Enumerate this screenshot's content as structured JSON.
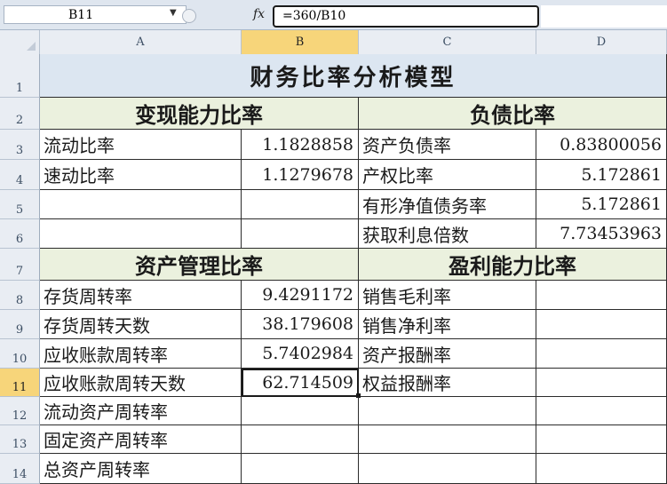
{
  "formula_bar": {
    "name_box": "B11",
    "formula": "=360/B10"
  },
  "columns": [
    "A",
    "B",
    "C",
    "D"
  ],
  "rows": [
    "1",
    "2",
    "3",
    "4",
    "5",
    "6",
    "7",
    "8",
    "9",
    "10",
    "11",
    "12",
    "13",
    "14"
  ],
  "sheet": {
    "title": "财务比率分析模型",
    "sections": {
      "liquidity": "变现能力比率",
      "debt": "负债比率",
      "asset_mgmt": "资产管理比率",
      "profit": "盈利能力比率"
    },
    "liquidity_rows": [
      {
        "label": "流动比率",
        "value": "1.1828858"
      },
      {
        "label": "速动比率",
        "value": "1.1279678"
      }
    ],
    "debt_rows": [
      {
        "label": "资产负债率",
        "value": "0.83800056"
      },
      {
        "label": "产权比率",
        "value": "5.172861"
      },
      {
        "label": "有形净值债务率",
        "value": "5.172861"
      },
      {
        "label": "获取利息倍数",
        "value": "7.73453963"
      }
    ],
    "asset_rows": [
      {
        "label": "存货周转率",
        "value": "9.4291172"
      },
      {
        "label": "存货周转天数",
        "value": "38.179608"
      },
      {
        "label": "应收账款周转率",
        "value": "5.7402984"
      },
      {
        "label": "应收账款周转天数",
        "value": "62.714509"
      },
      {
        "label": "流动资产周转率",
        "value": ""
      },
      {
        "label": "固定资产周转率",
        "value": ""
      },
      {
        "label": "总资产周转率",
        "value": ""
      }
    ],
    "profit_rows": [
      {
        "label": "销售毛利率",
        "value": ""
      },
      {
        "label": "销售净利率",
        "value": ""
      },
      {
        "label": "资产报酬率",
        "value": ""
      },
      {
        "label": "权益报酬率",
        "value": ""
      }
    ]
  },
  "colors": {
    "title_fill": "#dce6f1",
    "section_fill": "#ebf1de",
    "header_highlight": "#f7d57a"
  }
}
